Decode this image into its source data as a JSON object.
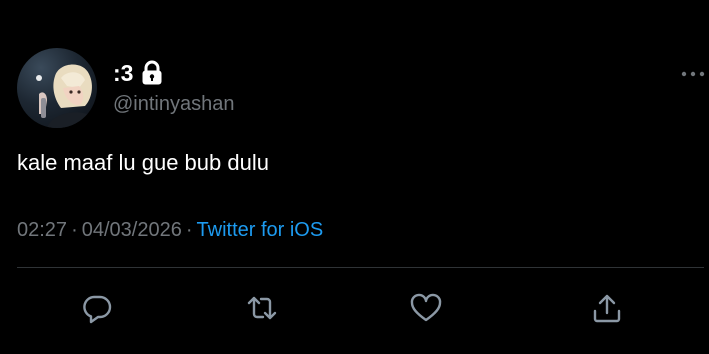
{
  "user": {
    "display_name": ":3",
    "handle": "@intinyashan",
    "protected": true,
    "avatar_icon": "profile-photo"
  },
  "tweet": {
    "text": "kale maaf lu gue bub dulu",
    "time": "02:27",
    "date": "04/03/2026",
    "separator": "·",
    "source": "Twitter for iOS"
  },
  "actions": [
    {
      "name": "reply",
      "icon": "reply-icon"
    },
    {
      "name": "retweet",
      "icon": "retweet-icon"
    },
    {
      "name": "like",
      "icon": "heart-icon"
    },
    {
      "name": "share",
      "icon": "share-icon"
    }
  ],
  "colors": {
    "background": "#000000",
    "primary_text": "#ffffff",
    "secondary_text": "#71767b",
    "link": "#1d9bf0",
    "divider": "#2f3336"
  }
}
